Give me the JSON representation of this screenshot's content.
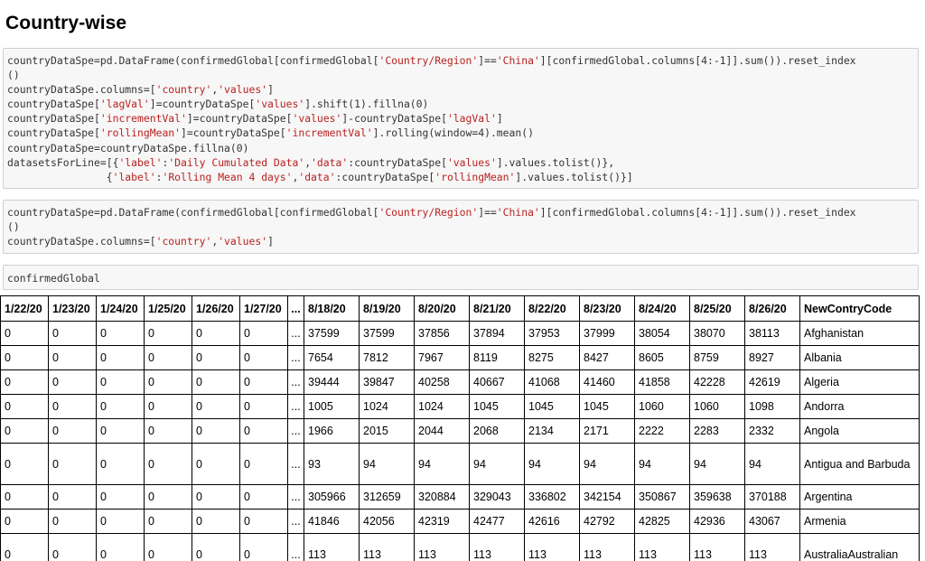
{
  "heading": "Country-wise",
  "cells": [
    {
      "lines": [
        [
          {
            "t": "countryDataSpe=pd.DataFrame(confirmedGlobal[confirmedGlobal["
          },
          {
            "t": "'Country/Region'",
            "s": 1
          },
          {
            "t": "]=="
          },
          {
            "t": "'China'",
            "s": 1
          },
          {
            "t": "][confirmedGlobal.columns[4:-1]].sum()).reset_index"
          }
        ],
        [
          {
            "t": "()"
          }
        ],
        [
          {
            "t": "countryDataSpe.columns=["
          },
          {
            "t": "'country'",
            "s": 1
          },
          {
            "t": ","
          },
          {
            "t": "'values'",
            "s": 1
          },
          {
            "t": "]"
          }
        ],
        [
          {
            "t": "countryDataSpe["
          },
          {
            "t": "'lagVal'",
            "s": 1
          },
          {
            "t": "]=countryDataSpe["
          },
          {
            "t": "'values'",
            "s": 1
          },
          {
            "t": "].shift(1).fillna(0)"
          }
        ],
        [
          {
            "t": "countryDataSpe["
          },
          {
            "t": "'incrementVal'",
            "s": 1
          },
          {
            "t": "]=countryDataSpe["
          },
          {
            "t": "'values'",
            "s": 1
          },
          {
            "t": "]-countryDataSpe["
          },
          {
            "t": "'lagVal'",
            "s": 1
          },
          {
            "t": "]"
          }
        ],
        [
          {
            "t": "countryDataSpe["
          },
          {
            "t": "'rollingMean'",
            "s": 1
          },
          {
            "t": "]=countryDataSpe["
          },
          {
            "t": "'incrementVal'",
            "s": 1
          },
          {
            "t": "].rolling(window=4).mean()"
          }
        ],
        [
          {
            "t": "countryDataSpe=countryDataSpe.fillna(0)"
          }
        ],
        [
          {
            "t": "datasetsForLine=[{"
          },
          {
            "t": "'label'",
            "s": 1
          },
          {
            "t": ":"
          },
          {
            "t": "'Daily Cumulated Data'",
            "s": 1
          },
          {
            "t": ","
          },
          {
            "t": "'data'",
            "s": 1
          },
          {
            "t": ":countryDataSpe["
          },
          {
            "t": "'values'",
            "s": 1
          },
          {
            "t": "].values.tolist()},"
          }
        ],
        [
          {
            "t": "                {"
          },
          {
            "t": "'label'",
            "s": 1
          },
          {
            "t": ":"
          },
          {
            "t": "'Rolling Mean 4 days'",
            "s": 1
          },
          {
            "t": ","
          },
          {
            "t": "'data'",
            "s": 1
          },
          {
            "t": ":countryDataSpe["
          },
          {
            "t": "'rollingMean'",
            "s": 1
          },
          {
            "t": "].values.tolist()}]"
          }
        ]
      ]
    },
    {
      "lines": [
        [
          {
            "t": "countryDataSpe=pd.DataFrame(confirmedGlobal[confirmedGlobal["
          },
          {
            "t": "'Country/Region'",
            "s": 1
          },
          {
            "t": "]=="
          },
          {
            "t": "'China'",
            "s": 1
          },
          {
            "t": "][confirmedGlobal.columns[4:-1]].sum()).reset_index"
          }
        ],
        [
          {
            "t": "()"
          }
        ],
        [
          {
            "t": "countryDataSpe.columns=["
          },
          {
            "t": "'country'",
            "s": 1
          },
          {
            "t": ","
          },
          {
            "t": "'values'",
            "s": 1
          },
          {
            "t": "]"
          }
        ]
      ]
    },
    {
      "lines": [
        [
          {
            "t": "confirmedGlobal"
          }
        ]
      ]
    }
  ],
  "table": {
    "headers": [
      "1/22/20",
      "1/23/20",
      "1/24/20",
      "1/25/20",
      "1/26/20",
      "1/27/20",
      "...",
      "8/18/20",
      "8/19/20",
      "8/20/20",
      "8/21/20",
      "8/22/20",
      "8/23/20",
      "8/24/20",
      "8/25/20",
      "8/26/20",
      "NewContryCode"
    ],
    "rows": [
      [
        "0",
        "0",
        "0",
        "0",
        "0",
        "0",
        "...",
        "37599",
        "37599",
        "37856",
        "37894",
        "37953",
        "37999",
        "38054",
        "38070",
        "38113",
        "Afghanistan"
      ],
      [
        "0",
        "0",
        "0",
        "0",
        "0",
        "0",
        "...",
        "7654",
        "7812",
        "7967",
        "8119",
        "8275",
        "8427",
        "8605",
        "8759",
        "8927",
        "Albania"
      ],
      [
        "0",
        "0",
        "0",
        "0",
        "0",
        "0",
        "...",
        "39444",
        "39847",
        "40258",
        "40667",
        "41068",
        "41460",
        "41858",
        "42228",
        "42619",
        "Algeria"
      ],
      [
        "0",
        "0",
        "0",
        "0",
        "0",
        "0",
        "...",
        "1005",
        "1024",
        "1024",
        "1045",
        "1045",
        "1045",
        "1060",
        "1060",
        "1098",
        "Andorra"
      ],
      [
        "0",
        "0",
        "0",
        "0",
        "0",
        "0",
        "...",
        "1966",
        "2015",
        "2044",
        "2068",
        "2134",
        "2171",
        "2222",
        "2283",
        "2332",
        "Angola"
      ],
      [
        "0",
        "0",
        "0",
        "0",
        "0",
        "0",
        "...",
        "93",
        "94",
        "94",
        "94",
        "94",
        "94",
        "94",
        "94",
        "94",
        "Antigua and Barbuda"
      ],
      [
        "0",
        "0",
        "0",
        "0",
        "0",
        "0",
        "...",
        "305966",
        "312659",
        "320884",
        "329043",
        "336802",
        "342154",
        "350867",
        "359638",
        "370188",
        "Argentina"
      ],
      [
        "0",
        "0",
        "0",
        "0",
        "0",
        "0",
        "...",
        "41846",
        "42056",
        "42319",
        "42477",
        "42616",
        "42792",
        "42825",
        "42936",
        "43067",
        "Armenia"
      ],
      [
        "0",
        "0",
        "0",
        "0",
        "0",
        "0",
        "...",
        "113",
        "113",
        "113",
        "113",
        "113",
        "113",
        "113",
        "113",
        "113",
        "AustraliaAustralian"
      ]
    ]
  }
}
